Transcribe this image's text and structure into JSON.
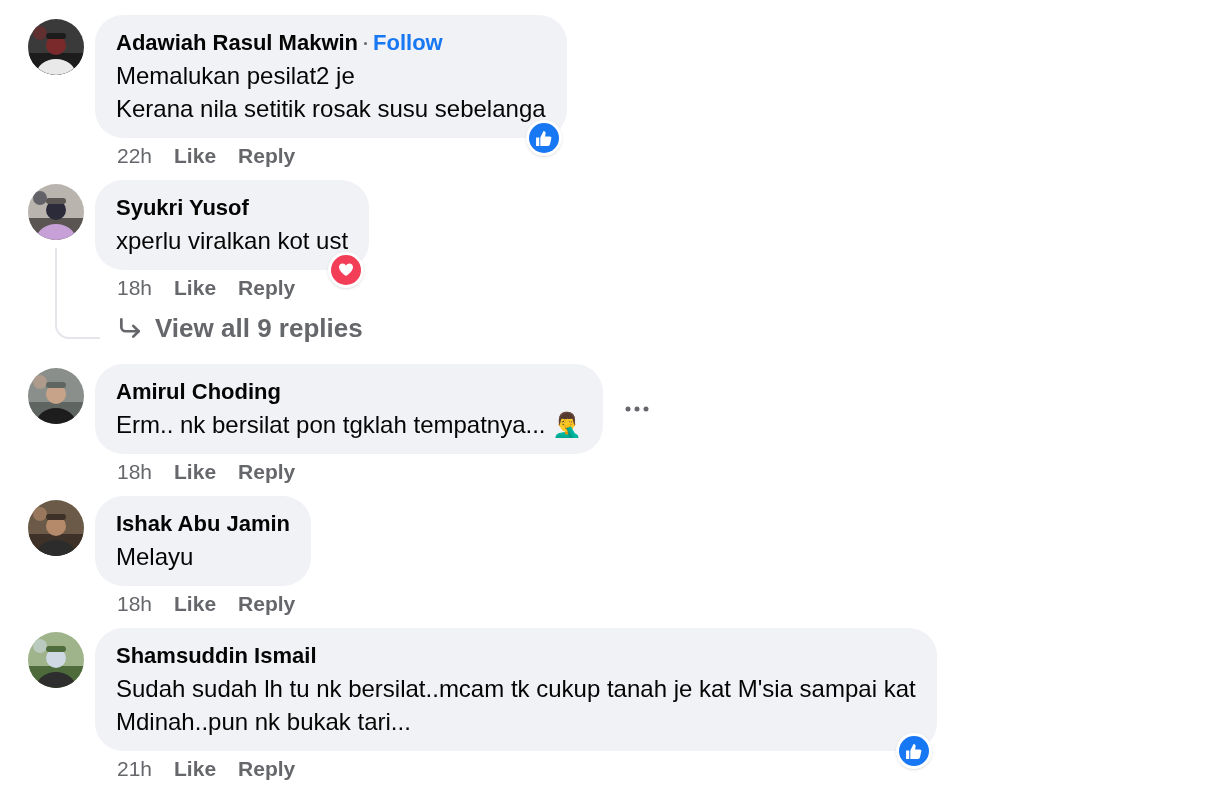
{
  "comments": [
    {
      "name": "Adawiah Rasul Makwin",
      "follow": "Follow",
      "lines": [
        "Memalukan pesilat2 je",
        "Kerana nila setitik rosak susu sebelanga"
      ],
      "time": "22h",
      "like": "Like",
      "reply": "Reply",
      "reaction": {
        "kind": "like"
      },
      "more_menu": false
    },
    {
      "name": "Syukri Yusof",
      "lines": [
        "xperlu viralkan kot ust"
      ],
      "time": "18h",
      "like": "Like",
      "reply": "Reply",
      "reaction": {
        "kind": "love"
      },
      "more_menu": false,
      "replies_link": "View all 9 replies"
    },
    {
      "name": "Amirul Choding",
      "lines": [
        "Erm.. nk bersilat pon tgklah tempatnya... 🤦‍♂️"
      ],
      "time": "18h",
      "like": "Like",
      "reply": "Reply",
      "more_menu": true
    },
    {
      "name": "Ishak Abu Jamin",
      "lines": [
        "Melayu"
      ],
      "time": "18h",
      "like": "Like",
      "reply": "Reply",
      "more_menu": false
    },
    {
      "name": "Shamsuddin Ismail",
      "lines": [
        "Sudah sudah lh tu nk bersilat..mcam tk cukup tanah je kat M'sia sampai kat",
        "Mdinah..pun nk bukak tari..."
      ],
      "time": "21h",
      "like": "Like",
      "reply": "Reply",
      "reaction": {
        "kind": "like"
      },
      "more_menu": false
    }
  ]
}
